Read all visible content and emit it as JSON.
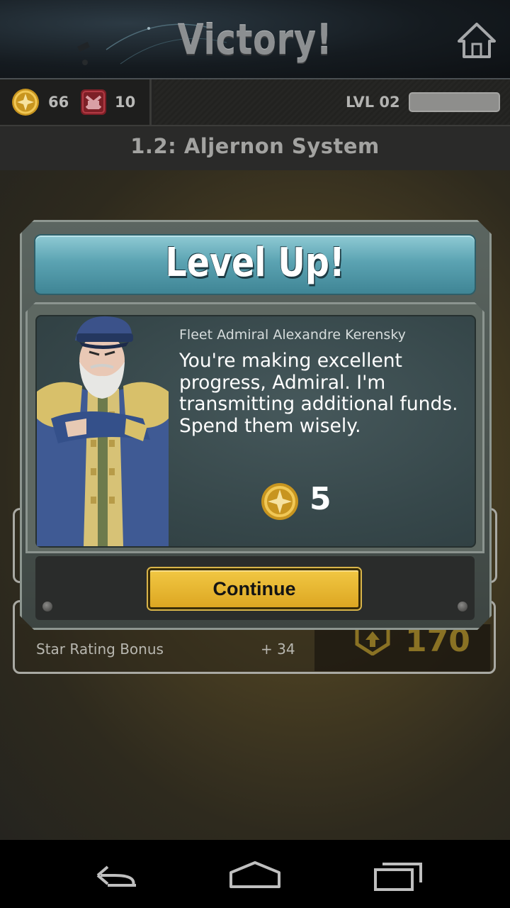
{
  "header": {
    "title": "Victory!",
    "home_icon": "home-icon"
  },
  "resources": {
    "credits": {
      "icon": "credit-coin-icon",
      "value": "66"
    },
    "tokens": {
      "icon": "pirate-token-icon",
      "value": "10"
    },
    "level_label": "LVL 02"
  },
  "system": {
    "title": "1.2: Aljernon System"
  },
  "background": {
    "bonus_label": "Star Rating Bonus",
    "bonus_value": "+ 34",
    "total": "170"
  },
  "dialog": {
    "title": "Level Up!",
    "speaker": "Fleet Admiral Alexandre Kerensky",
    "message": "You're making excellent progress, Admiral. I'm transmitting additional funds. Spend them wisely.",
    "reward_icon": "credit-coin-icon",
    "reward_amount": "5",
    "continue_label": "Continue"
  },
  "nav": {
    "back": "back-icon",
    "home": "home-icon",
    "recents": "recents-icon"
  },
  "colors": {
    "banner": "#5ba3b2",
    "button": "#e6b32d",
    "coin": "#d6a127"
  }
}
